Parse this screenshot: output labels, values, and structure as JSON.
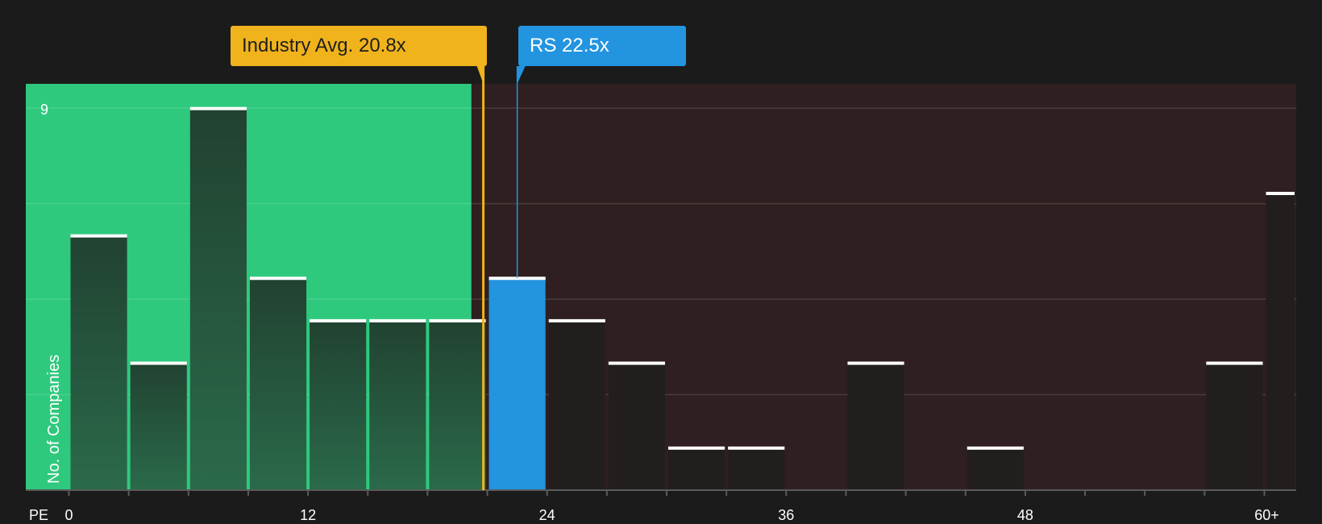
{
  "chart_data": {
    "type": "bar",
    "x_axis_label": "PE",
    "y_axis_label": "No. of Companies",
    "y_max_label": "9",
    "ylim": [
      0,
      9
    ],
    "xlim": [
      -2.2,
      61.7
    ],
    "x_ticks": [
      {
        "value": 0,
        "label": "0"
      },
      {
        "value": 12,
        "label": "12"
      },
      {
        "value": 24,
        "label": "24"
      },
      {
        "value": 36,
        "label": "36"
      },
      {
        "value": 48,
        "label": "48"
      },
      {
        "value": 60,
        "label": "60+"
      }
    ],
    "bins": [
      {
        "start": 0,
        "end": 3,
        "count": 6
      },
      {
        "start": 3,
        "end": 6,
        "count": 3
      },
      {
        "start": 6,
        "end": 9,
        "count": 9
      },
      {
        "start": 9,
        "end": 12,
        "count": 5
      },
      {
        "start": 12,
        "end": 15,
        "count": 4
      },
      {
        "start": 15,
        "end": 18,
        "count": 4
      },
      {
        "start": 18,
        "end": 21,
        "count": 4
      },
      {
        "start": 21,
        "end": 24,
        "count": 5,
        "highlight": true
      },
      {
        "start": 24,
        "end": 27,
        "count": 4
      },
      {
        "start": 27,
        "end": 30,
        "count": 3
      },
      {
        "start": 30,
        "end": 33,
        "count": 1
      },
      {
        "start": 33,
        "end": 36,
        "count": 1
      },
      {
        "start": 36,
        "end": 39,
        "count": 0
      },
      {
        "start": 39,
        "end": 42,
        "count": 3
      },
      {
        "start": 42,
        "end": 45,
        "count": 0
      },
      {
        "start": 45,
        "end": 48,
        "count": 1
      },
      {
        "start": 48,
        "end": 51,
        "count": 0
      },
      {
        "start": 51,
        "end": 54,
        "count": 0
      },
      {
        "start": 54,
        "end": 57,
        "count": 0
      },
      {
        "start": 57,
        "end": 60,
        "count": 3
      },
      {
        "start": 60,
        "end": 61.7,
        "count": 7
      }
    ],
    "industry_avg": {
      "value": 20.8,
      "label": "Industry Avg. 20.8x"
    },
    "company": {
      "value": 22.5,
      "label": "RS 22.5x"
    },
    "fair_region_end": 20.2,
    "grid": true,
    "colors": {
      "background": "#1b1b1b",
      "good_region": "#2ec97d",
      "bad_region": "#2f1f20",
      "bar_in_good": "#234b37",
      "bar_in_bad": "#231e1e",
      "highlight_bar": "#2394e0",
      "industry": "#f0b31c",
      "company": "#2394e0",
      "cap": "#ffffff"
    }
  }
}
